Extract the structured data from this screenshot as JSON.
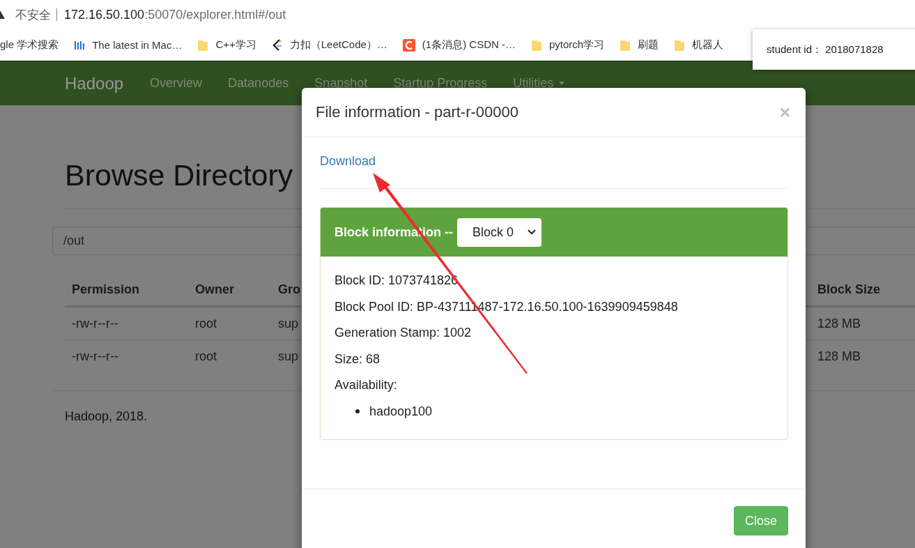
{
  "browser": {
    "security_label": "不安全",
    "url_host": "172.16.50.100",
    "url_rest": ":50070/explorer.html#/out"
  },
  "bookmarks": [
    {
      "label": "gle 学术搜索",
      "kind": "none"
    },
    {
      "label": "The latest in Mac…",
      "kind": "bars"
    },
    {
      "label": "C++学习",
      "kind": "folder"
    },
    {
      "label": "力扣（LeetCode）…",
      "kind": "leetcode"
    },
    {
      "label": "(1条消息) CSDN -…",
      "kind": "csdn"
    },
    {
      "label": "pytorch学习",
      "kind": "folder"
    },
    {
      "label": "刷题",
      "kind": "folder"
    },
    {
      "label": "机器人",
      "kind": "folder"
    }
  ],
  "tooltip": {
    "text": "student id： 2018071828"
  },
  "navbar": {
    "brand": "Hadoop",
    "items": [
      {
        "label": "Overview",
        "dropdown": false
      },
      {
        "label": "Datanodes",
        "dropdown": false
      },
      {
        "label": "Snapshot",
        "dropdown": false
      },
      {
        "label": "Startup Progress",
        "dropdown": false
      },
      {
        "label": "Utilities",
        "dropdown": true
      }
    ]
  },
  "page": {
    "title": "Browse Directory",
    "path": "/out",
    "table": {
      "columns": [
        "Permission",
        "Owner",
        "Gro",
        "Block Size"
      ],
      "rows": [
        [
          "-rw-r--r--",
          "root",
          "sup",
          "128 MB"
        ],
        [
          "-rw-r--r--",
          "root",
          "sup",
          "128 MB"
        ]
      ]
    },
    "footer": "Hadoop, 2018."
  },
  "modal": {
    "title": "File information - part-r-00000",
    "close": "×",
    "download": "Download",
    "panel": {
      "title": "Block information --",
      "block_select": "Block 0",
      "fields": [
        "Block ID: 1073741826",
        "Block Pool ID: BP-437111487-172.16.50.100-1639909459848",
        "Generation Stamp: 1002",
        "Size: 68"
      ],
      "availability_label": "Availability:",
      "availability": [
        "hadoop100"
      ]
    },
    "close_button": "Close"
  }
}
